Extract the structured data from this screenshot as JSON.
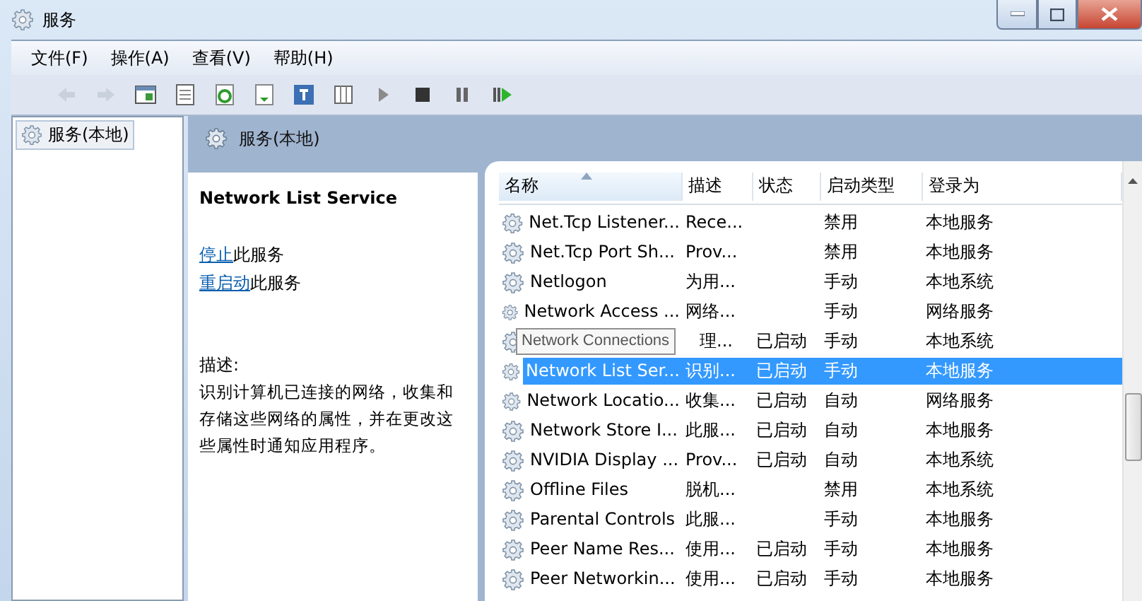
{
  "window": {
    "title": "服务"
  },
  "menu": [
    {
      "label": "文件(F)"
    },
    {
      "label": "操作(A)"
    },
    {
      "label": "查看(V)"
    },
    {
      "label": "帮助(H)"
    }
  ],
  "tree": {
    "items": [
      {
        "label": "服务(本地)",
        "selected": true
      }
    ]
  },
  "pane_header": {
    "title": "服务(本地)"
  },
  "details": {
    "service_name": "Network List Service",
    "actions": [
      {
        "link": "停止",
        "text": "此服务"
      },
      {
        "link": "重启动",
        "text": "此服务"
      }
    ],
    "description_label": "描述:",
    "description": "识别计算机已连接的网络，收集和存储这些网络的属性，并在更改这些属性时通知应用程序。"
  },
  "table": {
    "columns": [
      {
        "label": "名称",
        "sorted": true
      },
      {
        "label": "描述",
        "sorted": false
      },
      {
        "label": "状态",
        "sorted": false
      },
      {
        "label": "启动类型",
        "sorted": false
      },
      {
        "label": "登录为",
        "sorted": false
      }
    ],
    "rows": [
      {
        "name": "Net.Tcp Listener...",
        "description": "Rece...",
        "status": "",
        "startup_type": "禁用",
        "logon_as": "本地服务",
        "selected": false
      },
      {
        "name": "Net.Tcp Port Sh...",
        "description": "Prov...",
        "status": "",
        "startup_type": "禁用",
        "logon_as": "本地服务",
        "selected": false
      },
      {
        "name": "Netlogon",
        "description": "为用...",
        "status": "",
        "startup_type": "手动",
        "logon_as": "本地系统",
        "selected": false
      },
      {
        "name": "Network Access ...",
        "description": "网络...",
        "status": "",
        "startup_type": "手动",
        "logon_as": "网络服务",
        "selected": false
      },
      {
        "name": "",
        "tooltip": "Network Connections",
        "description": "理...",
        "status": "已启动",
        "startup_type": "手动",
        "logon_as": "本地系统",
        "selected": false
      },
      {
        "name": "Network List Ser...",
        "description": "识别...",
        "status": "已启动",
        "startup_type": "手动",
        "logon_as": "本地服务",
        "selected": true
      },
      {
        "name": "Network Locatio...",
        "description": "收集...",
        "status": "已启动",
        "startup_type": "自动",
        "logon_as": "网络服务",
        "selected": false
      },
      {
        "name": "Network Store I...",
        "description": "此服...",
        "status": "已启动",
        "startup_type": "自动",
        "logon_as": "本地服务",
        "selected": false
      },
      {
        "name": "NVIDIA Display ...",
        "description": "Prov...",
        "status": "已启动",
        "startup_type": "自动",
        "logon_as": "本地系统",
        "selected": false
      },
      {
        "name": "Offline Files",
        "description": "脱机...",
        "status": "",
        "startup_type": "禁用",
        "logon_as": "本地系统",
        "selected": false
      },
      {
        "name": "Parental Controls",
        "description": "此服...",
        "status": "",
        "startup_type": "手动",
        "logon_as": "本地服务",
        "selected": false
      },
      {
        "name": "Peer Name Res...",
        "description": "使用...",
        "status": "已启动",
        "startup_type": "手动",
        "logon_as": "本地服务",
        "selected": false
      },
      {
        "name": "Peer Networkin...",
        "description": "使用...",
        "status": "已启动",
        "startup_type": "手动",
        "logon_as": "本地服务",
        "selected": false
      }
    ]
  }
}
